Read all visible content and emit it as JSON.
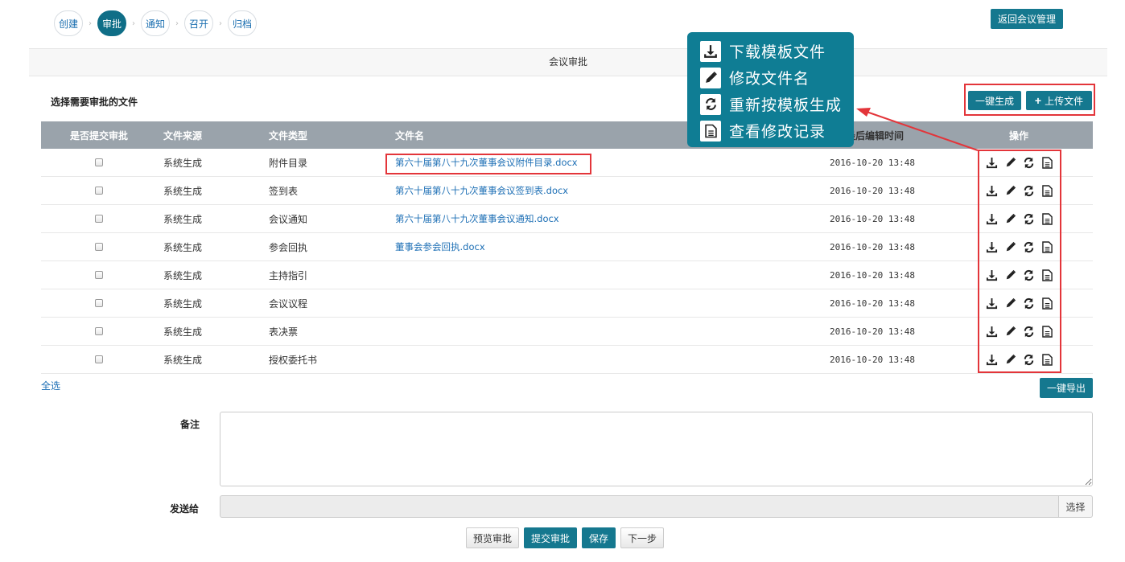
{
  "steps": [
    {
      "label": "创建",
      "active": false
    },
    {
      "label": "审批",
      "active": true
    },
    {
      "label": "通知",
      "active": false
    },
    {
      "label": "召开",
      "active": false
    },
    {
      "label": "归档",
      "active": false
    }
  ],
  "header": {
    "back_button": "返回会议管理",
    "section_title": "会议审批"
  },
  "file_section": {
    "title": "选择需要审批的文件",
    "generate_all_button": "一键生成",
    "upload_button": "上传文件"
  },
  "table": {
    "columns": {
      "submit": "是否提交审批",
      "source": "文件来源",
      "type": "文件类型",
      "name": "文件名",
      "time": "最后编辑时间",
      "ops": "操作"
    },
    "rows": [
      {
        "source": "系统生成",
        "type": "附件目录",
        "name": "第六十届第八十九次董事会议附件目录.docx",
        "time": "2016-10-20 13:48"
      },
      {
        "source": "系统生成",
        "type": "签到表",
        "name": "第六十届第八十九次董事会议签到表.docx",
        "time": "2016-10-20 13:48"
      },
      {
        "source": "系统生成",
        "type": "会议通知",
        "name": "第六十届第八十九次董事会议通知.docx",
        "time": "2016-10-20 13:48"
      },
      {
        "source": "系统生成",
        "type": "参会回执",
        "name": "董事会参会回执.docx",
        "time": "2016-10-20 13:48"
      },
      {
        "source": "系统生成",
        "type": "主持指引",
        "name": "",
        "time": "2016-10-20 13:48"
      },
      {
        "source": "系统生成",
        "type": "会议议程",
        "name": "",
        "time": "2016-10-20 13:48"
      },
      {
        "source": "系统生成",
        "type": "表决票",
        "name": "",
        "time": "2016-10-20 13:48"
      },
      {
        "source": "系统生成",
        "type": "授权委托书",
        "name": "",
        "time": "2016-10-20 13:48"
      }
    ]
  },
  "select_all": "全选",
  "export_button": "一键导出",
  "form": {
    "note_label": "备注",
    "send_label": "发送给",
    "choose_button": "选择"
  },
  "bottom_buttons": {
    "preview": "预览审批",
    "submit": "提交审批",
    "save": "保存",
    "next": "下一步"
  },
  "tooltip": {
    "download": "下载模板文件",
    "edit": "修改文件名",
    "regenerate": "重新按模板生成",
    "history": "查看修改记录"
  },
  "icons": {
    "download": "download-icon",
    "edit": "pencil-icon",
    "regenerate": "refresh-icon",
    "history": "document-icon"
  },
  "colors": {
    "accent": "#15788f",
    "header_gray": "#9aa3ab",
    "link": "#1d6fb5",
    "highlight": "#e3353a",
    "tooltip": "#0f7d94"
  }
}
